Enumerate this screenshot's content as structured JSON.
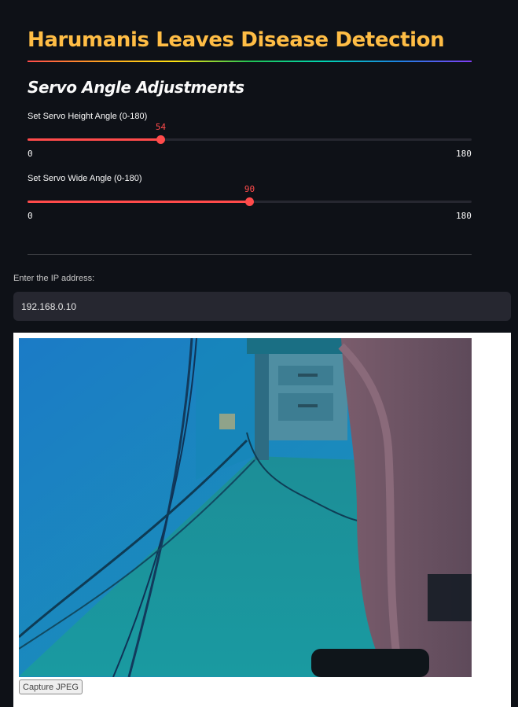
{
  "header": {
    "title": "Harumanis Leaves Disease Detection",
    "title_color": "#ffbd45"
  },
  "servo": {
    "subheader": "Servo Angle Adjustments",
    "sliders": [
      {
        "label": "Set Servo Height Angle (0-180)",
        "value": "54",
        "min": "0",
        "max": "180",
        "fraction": 0.3
      },
      {
        "label": "Set Servo Wide Angle (0-180)",
        "value": "90",
        "min": "0",
        "max": "180",
        "fraction": 0.5
      }
    ],
    "accent_color": "#ff4b4b"
  },
  "ip": {
    "label": "Enter the IP address:",
    "value": "192.168.0.10"
  },
  "camera": {
    "capture_label": "Capture JPEG"
  },
  "theme": {
    "background": "#0e1117",
    "input_background": "#262730"
  }
}
